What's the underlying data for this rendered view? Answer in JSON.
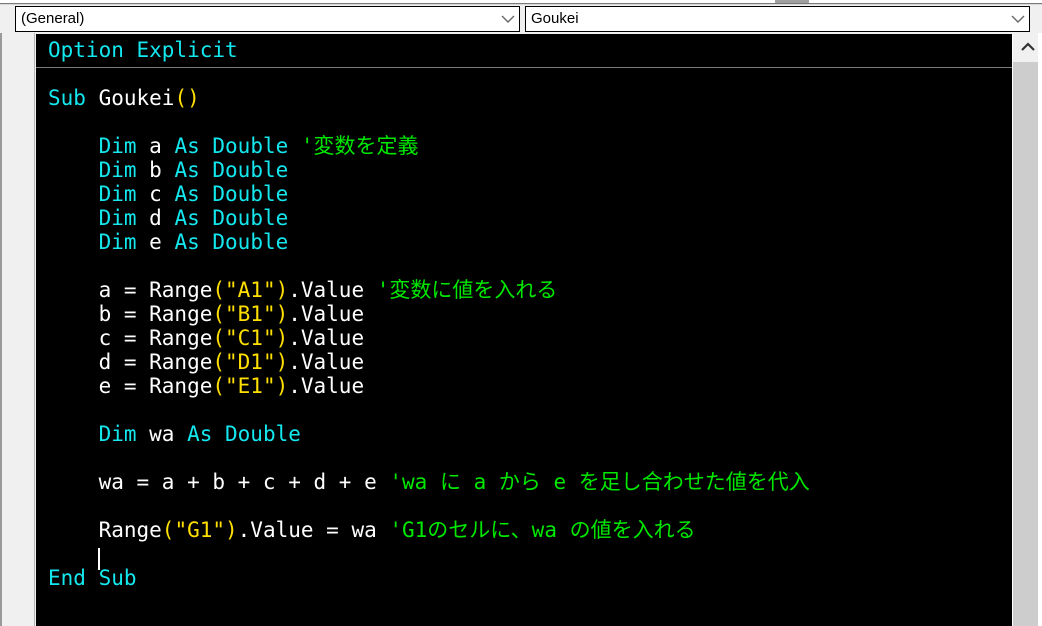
{
  "window": {
    "app": "Microsoft Visual Basic for Applications - Code Window"
  },
  "toolbar": {
    "object_combo": {
      "value": "(General)",
      "arrow_icon": "chevron-down-icon"
    },
    "procedure_combo": {
      "value": "Goukei",
      "arrow_icon": "chevron-down-icon"
    }
  },
  "scrollbar": {
    "up_arrow_icon": "chevron-up-icon"
  },
  "colors": {
    "keyword": "#13e8ef",
    "identifier": "#ffffff",
    "string": "#ffe000",
    "comment": "#00e800",
    "background": "#000000"
  },
  "code": {
    "lines": [
      {
        "id": 1,
        "tokens": [
          {
            "t": "Option Explicit",
            "c": "kw"
          }
        ]
      },
      {
        "id": 2,
        "tokens": []
      },
      {
        "id": 3,
        "tokens": [
          {
            "t": "Sub ",
            "c": "kw"
          },
          {
            "t": "Goukei",
            "c": "id"
          },
          {
            "t": "()",
            "c": "str"
          }
        ]
      },
      {
        "id": 4,
        "tokens": []
      },
      {
        "id": 5,
        "tokens": [
          {
            "t": "    Dim ",
            "c": "kw"
          },
          {
            "t": "a",
            "c": "id"
          },
          {
            "t": " As Double",
            "c": "kw"
          },
          {
            "t": " '変数を定義",
            "c": "cm"
          }
        ]
      },
      {
        "id": 6,
        "tokens": [
          {
            "t": "    Dim ",
            "c": "kw"
          },
          {
            "t": "b",
            "c": "id"
          },
          {
            "t": " As Double",
            "c": "kw"
          }
        ]
      },
      {
        "id": 7,
        "tokens": [
          {
            "t": "    Dim ",
            "c": "kw"
          },
          {
            "t": "c",
            "c": "id"
          },
          {
            "t": " As Double",
            "c": "kw"
          }
        ]
      },
      {
        "id": 8,
        "tokens": [
          {
            "t": "    Dim ",
            "c": "kw"
          },
          {
            "t": "d",
            "c": "id"
          },
          {
            "t": " As Double",
            "c": "kw"
          }
        ]
      },
      {
        "id": 9,
        "tokens": [
          {
            "t": "    Dim ",
            "c": "kw"
          },
          {
            "t": "e",
            "c": "id"
          },
          {
            "t": " As Double",
            "c": "kw"
          }
        ]
      },
      {
        "id": 10,
        "tokens": []
      },
      {
        "id": 11,
        "tokens": [
          {
            "t": "    a = Range",
            "c": "id"
          },
          {
            "t": "(\"A1\")",
            "c": "str"
          },
          {
            "t": ".Value",
            "c": "id"
          },
          {
            "t": " '変数に値を入れる",
            "c": "cm"
          }
        ]
      },
      {
        "id": 12,
        "tokens": [
          {
            "t": "    b = Range",
            "c": "id"
          },
          {
            "t": "(\"B1\")",
            "c": "str"
          },
          {
            "t": ".Value",
            "c": "id"
          }
        ]
      },
      {
        "id": 13,
        "tokens": [
          {
            "t": "    c = Range",
            "c": "id"
          },
          {
            "t": "(\"C1\")",
            "c": "str"
          },
          {
            "t": ".Value",
            "c": "id"
          }
        ]
      },
      {
        "id": 14,
        "tokens": [
          {
            "t": "    d = Range",
            "c": "id"
          },
          {
            "t": "(\"D1\")",
            "c": "str"
          },
          {
            "t": ".Value",
            "c": "id"
          }
        ]
      },
      {
        "id": 15,
        "tokens": [
          {
            "t": "    e = Range",
            "c": "id"
          },
          {
            "t": "(\"E1\")",
            "c": "str"
          },
          {
            "t": ".Value",
            "c": "id"
          }
        ]
      },
      {
        "id": 16,
        "tokens": []
      },
      {
        "id": 17,
        "tokens": [
          {
            "t": "    Dim ",
            "c": "kw"
          },
          {
            "t": "wa",
            "c": "id"
          },
          {
            "t": " As Double",
            "c": "kw"
          }
        ]
      },
      {
        "id": 18,
        "tokens": []
      },
      {
        "id": 19,
        "tokens": [
          {
            "t": "    wa = a + b + c + d + e",
            "c": "id"
          },
          {
            "t": " 'wa に a から e を足し合わせた値を代入",
            "c": "cm"
          }
        ]
      },
      {
        "id": 20,
        "tokens": []
      },
      {
        "id": 21,
        "tokens": [
          {
            "t": "    Range",
            "c": "id"
          },
          {
            "t": "(\"G1\")",
            "c": "str"
          },
          {
            "t": ".Value = wa",
            "c": "id"
          },
          {
            "t": " 'G1のセルに、wa の値を入れる",
            "c": "cm"
          }
        ]
      },
      {
        "id": 22,
        "tokens": []
      },
      {
        "id": 23,
        "tokens": [
          {
            "t": "End Sub",
            "c": "kw"
          }
        ]
      }
    ]
  }
}
